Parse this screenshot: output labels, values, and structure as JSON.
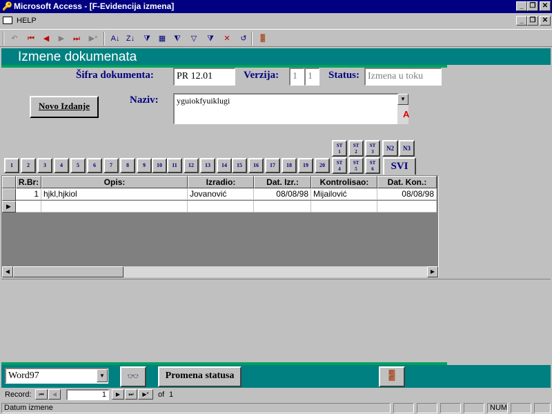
{
  "window": {
    "app_title": "Microsoft Access - [F-Evidencija izmena]",
    "minimize": "_",
    "restore": "❐",
    "close": "✕"
  },
  "menu": {
    "help": "HELP"
  },
  "form": {
    "title": "Izmene dokumenata",
    "sifra_label": "Šifra dokumenta:",
    "sifra_value": "PR 12.01",
    "verzija_label": "Verzija:",
    "verzija_major": "1",
    "verzija_minor": "1",
    "status_label": "Status:",
    "status_value": "Izmena u toku",
    "novo_izdanje": "Novo Izdanje",
    "naziv_label": "Naziv:",
    "naziv_value": "yguiokfyuiklugi",
    "naziv_marker": "A"
  },
  "pages": [
    "1",
    "2",
    "3",
    "4",
    "5",
    "6",
    "7",
    "8",
    "9",
    "10",
    "11",
    "12",
    "13",
    "14",
    "15",
    "16",
    "17",
    "18",
    "19",
    "20"
  ],
  "st_top": [
    "ST 1",
    "ST 2",
    "ST 3"
  ],
  "st_bottom": [
    "ST 4",
    "ST 5",
    "ST 6"
  ],
  "n_tabs": [
    "N2",
    "N3"
  ],
  "svi": "SVI",
  "grid": {
    "columns": [
      "R.Br:",
      "Opis:",
      "Izradio:",
      "Dat. Izr.:",
      "Kontrolisao:",
      "Dat. Kon.:"
    ],
    "rows": [
      [
        "1",
        "hjkl,hjkiol",
        "Jovanović",
        "08/08/98",
        "Mijailović",
        "08/08/98"
      ]
    ]
  },
  "footer": {
    "word_select": "Word97",
    "promena_statusa": "Promena statusa"
  },
  "navigation": {
    "record_label": "Record:",
    "current": "1",
    "of_label": "of",
    "total": "1"
  },
  "statusbar": {
    "text": "Datum izmene",
    "num": "NUM"
  },
  "colors": {
    "titlebar": "#000080",
    "header": "#008080",
    "accent_line": "#00a060",
    "label": "#000080"
  }
}
